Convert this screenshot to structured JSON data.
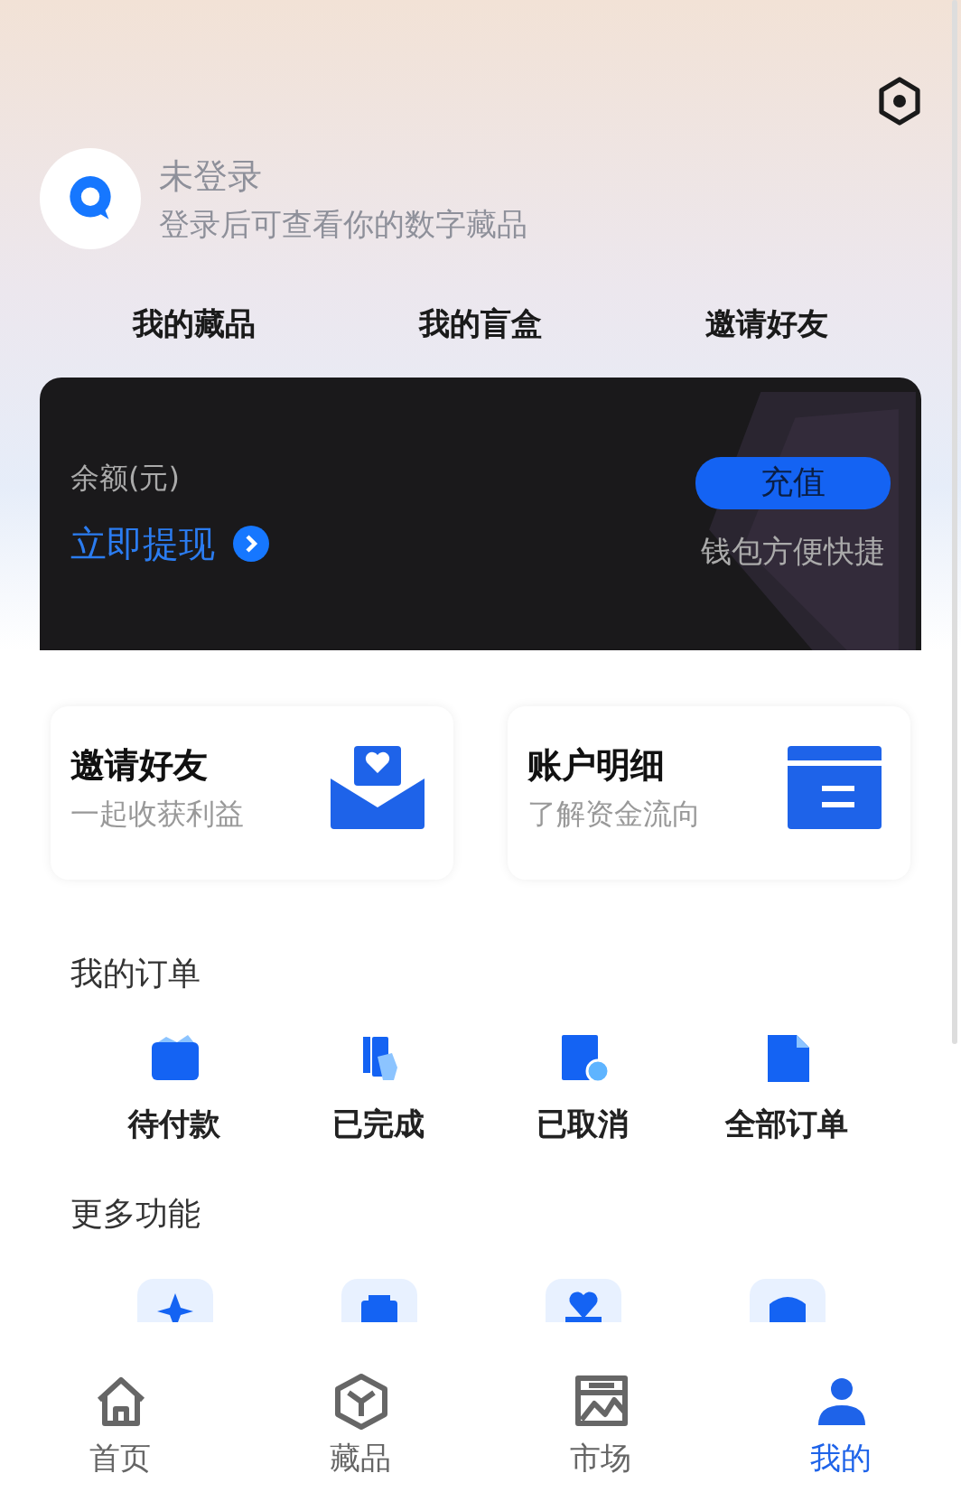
{
  "profile": {
    "name": "未登录",
    "subtitle": "登录后可查看你的数字藏品"
  },
  "shortcuts": [
    "我的藏品",
    "我的盲盒",
    "邀请好友"
  ],
  "wallet": {
    "balance_label": "余额(元)",
    "withdraw_link": "立即提现",
    "recharge_button": "充值",
    "note": "钱包方便快捷"
  },
  "feature_cards": [
    {
      "title": "邀请好友",
      "subtitle": "一起收获利益",
      "kind": "invite"
    },
    {
      "title": "账户明细",
      "subtitle": "了解资金流向",
      "kind": "ledger"
    }
  ],
  "orders": {
    "title": "我的订单",
    "items": [
      {
        "label": "待付款",
        "kind": "pending"
      },
      {
        "label": "已完成",
        "kind": "done"
      },
      {
        "label": "已取消",
        "kind": "cancelled"
      },
      {
        "label": "全部订单",
        "kind": "all"
      }
    ]
  },
  "more": {
    "title": "更多功能",
    "items": [
      {
        "kind": "star"
      },
      {
        "kind": "bag"
      },
      {
        "kind": "heart"
      },
      {
        "kind": "shield"
      }
    ]
  },
  "tab_bar": [
    {
      "label": "首页",
      "kind": "home",
      "selected": false
    },
    {
      "label": "藏品",
      "kind": "box",
      "selected": false
    },
    {
      "label": "市场",
      "kind": "market",
      "selected": false
    },
    {
      "label": "我的",
      "kind": "me",
      "selected": true
    }
  ]
}
